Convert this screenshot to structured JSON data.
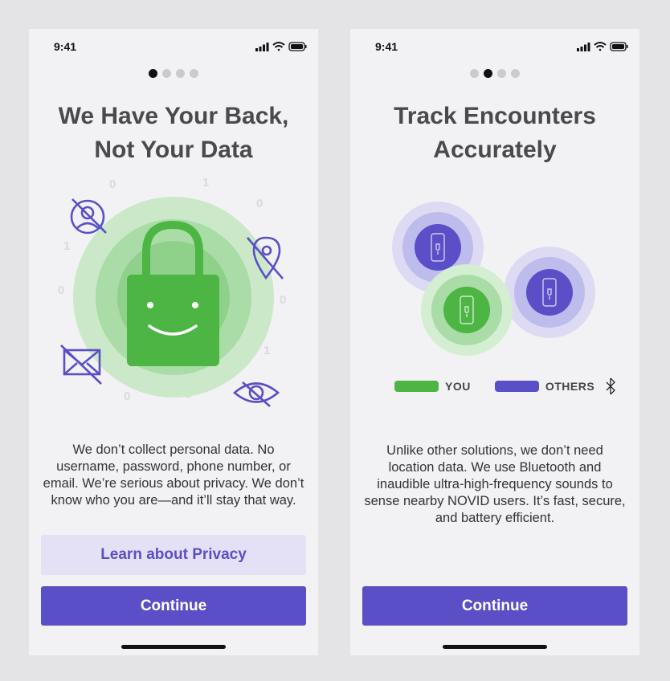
{
  "screens": [
    {
      "status": {
        "time": "9:41"
      },
      "pagination": {
        "active_index": 0,
        "count": 4
      },
      "title_line1": "We Have Your Back,",
      "title_line2": "Not Your Data",
      "body": "We don’t collect personal data. No username, password, phone number, or email. We’re serious about privacy. We don’t know who you are—and it’ll stay that way.",
      "secondary_button": "Learn about Privacy",
      "primary_button": "Continue",
      "illustration": {
        "icons": [
          "lock-face-icon",
          "hidden-user-icon",
          "hidden-location-icon",
          "no-email-icon",
          "hidden-eye-icon"
        ],
        "binary_digits": [
          "0",
          "1",
          "0",
          "0",
          "1",
          "0",
          "1",
          "0",
          "0",
          "1",
          "0",
          "1",
          "0",
          "1",
          "0",
          "0"
        ]
      }
    },
    {
      "status": {
        "time": "9:41"
      },
      "pagination": {
        "active_index": 1,
        "count": 4
      },
      "title_line1": "Track Encounters",
      "title_line2": "Accurately",
      "body": "Unlike other solutions, we don’t need location data. We use Bluetooth and inaudible ultra-high-frequency sounds to sense nearby NOVID users. It’s fast, secure, and battery efficient.",
      "primary_button": "Continue",
      "legend": {
        "you_label": "YOU",
        "others_label": "OTHERS"
      },
      "illustration": {
        "icons": [
          "phone-icon",
          "bluetooth-icon"
        ]
      }
    }
  ],
  "colors": {
    "accent": "#5a4fc7",
    "accent_light": "#e4e1f6",
    "green": "#4cb543",
    "green_light": "#b9e3b8",
    "purple_icon": "#5a4fc7",
    "dot_inactive": "#cbcbcf",
    "dot_active": "#111111"
  }
}
